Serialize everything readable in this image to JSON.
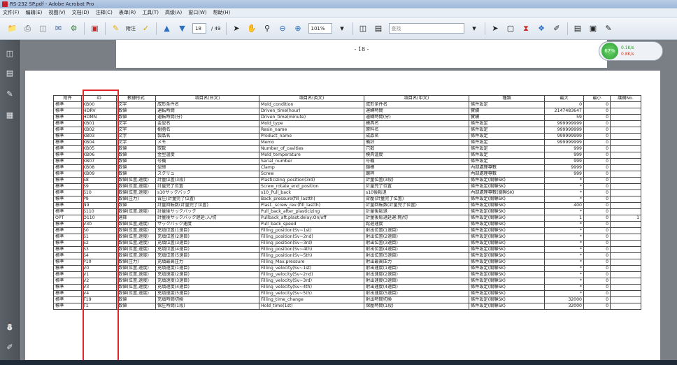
{
  "window": {
    "title": "RS-232 SP.pdf - Adobe Acrobat Pro"
  },
  "menu": [
    "文件(F)",
    "编辑(E)",
    "视图(V)",
    "文档(D)",
    "注释(C)",
    "表单(R)",
    "工具(T)",
    "高级(A)",
    "窗口(W)",
    "帮助(H)"
  ],
  "toolbar": {
    "attach_label": "附注",
    "page_current": "18",
    "page_total": "/ 49",
    "zoom_value": "101%",
    "search_placeholder": "查找"
  },
  "doc": {
    "page_number": "- 18 -"
  },
  "zoom_widget": {
    "percent": "67%",
    "up": "0.1K/s",
    "down": "0.8K/s"
  },
  "table": {
    "headers": [
      "附件",
      "ID",
      "數據形式",
      "項目名(日文)",
      "項目名(英文)",
      "項目名(中文)",
      "種類",
      "最大",
      "最小",
      "護欄No."
    ],
    "rows": [
      [
        "標準",
        "KB00",
        "文字",
        "成形条件名",
        "Mold_condition",
        "成形条件名",
        "條件設定",
        "0",
        "0",
        ""
      ],
      [
        "標準",
        "HDRV",
        "数値",
        "運転時間",
        "Driven_time(hour)",
        "運轉時間",
        "實績",
        "2147483647",
        "0",
        ""
      ],
      [
        "標準",
        "HDMN",
        "数値",
        "運転時間(分)",
        "Driven_time(minute)",
        "運轉時間(分)",
        "實績",
        "59",
        "0",
        ""
      ],
      [
        "標準",
        "KB01",
        "文字",
        "金型名",
        "Mold_type",
        "模具名",
        "條件設定",
        "999999999",
        "0",
        ""
      ],
      [
        "標準",
        "KB02",
        "文字",
        "樹脂名",
        "Resin_name",
        "原料名",
        "條件設定",
        "999999999",
        "0",
        ""
      ],
      [
        "標準",
        "KB03",
        "文字",
        "製品名",
        "Product_name",
        "成品名",
        "條件設定",
        "999999999",
        "0",
        ""
      ],
      [
        "標準",
        "KB04",
        "文字",
        "メモ",
        "Memo",
        "備註",
        "條件設定",
        "999999999",
        "0",
        ""
      ],
      [
        "標準",
        "KB05",
        "数値",
        "取数",
        "Number_of_cavities",
        "穴数",
        "條件設定",
        "999",
        "0",
        ""
      ],
      [
        "標準",
        "KB06",
        "数値",
        "金型温度",
        "Mold_temperature",
        "模具溫度",
        "條件設定",
        "999",
        "0",
        ""
      ],
      [
        "標準",
        "KB07",
        "数値",
        "号機",
        "Serial_number",
        "号機",
        "條件設定",
        "999",
        "0",
        ""
      ],
      [
        "標準",
        "KB08",
        "数値",
        "型締",
        "Clamp",
        "鎖模",
        "內部處理專數",
        "9999",
        "0",
        ""
      ],
      [
        "標準",
        "KB09",
        "数値",
        "スクリュ",
        "Screw",
        "螺桿",
        "內部處理專數",
        "999",
        "0",
        ""
      ],
      [
        "標準",
        "S8",
        "数値(位置,速度)",
        "計量位置(3段)",
        "Plasticizing_position(3rd)",
        "計量位置(3段)",
        "條件設定(關聯SK)",
        "*",
        "0",
        ""
      ],
      [
        "標準",
        "S9",
        "数値(位置,速度)",
        "計量完了位置",
        "Screw_rotate_end_position",
        "計量完了位置",
        "條件設定(關聯SK)",
        "*",
        "0",
        ""
      ],
      [
        "標準",
        "S10",
        "数値(位置,速度)",
        "s10サックバック",
        "s10_Pull_back",
        "s10後鬆退",
        "內部處理專數(關聯SK)",
        "*",
        "0",
        ""
      ],
      [
        "標準",
        "P9",
        "数値(圧力)",
        "背圧(計量完了位置)",
        "Back_pressure(fill_lastth)",
        "背壓(計量完了位置)",
        "條件設定(關聯SK)",
        "*",
        "0",
        ""
      ],
      [
        "標準",
        "N9",
        "数値",
        "計量回転数(計量完了位置)",
        "Plast._screw_rev.(fill_lastth)",
        "計量回転数(計量完了位置)",
        "條件設定(關聯SK)",
        "400",
        "0",
        ""
      ],
      [
        "標準",
        "S110",
        "数値(位置,速度)",
        "計量後サックバック",
        "Pull_back_after_plasticizing",
        "計量後鬆退",
        "條件設定(關聯SK)",
        "*",
        "0",
        ""
      ],
      [
        "OPT",
        "O110",
        "選擇",
        "計量後サックバック遅延:入/切",
        "Pullback_aft.plast.delay:On/off",
        "計量後鬆退延遲:開/切",
        "條件設定(關聯SK)",
        "1",
        "0",
        "1"
      ],
      [
        "標準",
        "V30",
        "数値(位置,速度)",
        "サックバック速度",
        "Pull_back_speed",
        "鬆退速度",
        "條件設定(關聯SK)",
        "*",
        "0",
        ""
      ],
      [
        "標準",
        "S0",
        "数値(位置,速度)",
        "充填位置(1速目)",
        "Filling_position(Sv~1st)",
        "射出位置(1速目)",
        "條件設定(關聯SK)",
        "*",
        "0",
        ""
      ],
      [
        "標準",
        "S1",
        "数値(位置,速度)",
        "充填位置(2速目)",
        "Filling_position(Sv~2nd)",
        "射出位置(2速目)",
        "條件設定(關聯SK)",
        "*",
        "0",
        ""
      ],
      [
        "標準",
        "S2",
        "数値(位置,速度)",
        "充填位置(3速目)",
        "Filling_position(Sv~3rd)",
        "射出位置(3速目)",
        "條件設定(關聯SK)",
        "*",
        "0",
        ""
      ],
      [
        "標準",
        "S3",
        "数値(位置,速度)",
        "充填位置(4速目)",
        "Filling_position(Sv~4th)",
        "射出位置(4速目)",
        "條件設定(關聯SK)",
        "*",
        "0",
        ""
      ],
      [
        "標準",
        "S4",
        "数値(位置,速度)",
        "充填位置(5速目)",
        "Filling_position(Sv~5th)",
        "射出位置(5速目)",
        "條件設定(關聯SK)",
        "*",
        "0",
        ""
      ],
      [
        "標準",
        "P10",
        "数値(圧力)",
        "充填最高圧力",
        "Filling_Max.pressure",
        "射出最高压力",
        "條件設定(關聯SK)",
        "*",
        "0",
        ""
      ],
      [
        "標準",
        "V0",
        "数値(位置,速度)",
        "充填速度(1速目)",
        "Filling_velocity(Sv~1st)",
        "射出速度(1速目)",
        "條件設定(關聯SK)",
        "*",
        "0",
        ""
      ],
      [
        "標準",
        "V1",
        "数値(位置,速度)",
        "充填速度(2速目)",
        "Filling_velocity(Sv~2nd)",
        "射出速度(2速目)",
        "條件設定(關聯SK)",
        "*",
        "0",
        ""
      ],
      [
        "標準",
        "V2",
        "数値(位置,速度)",
        "充填速度(3速目)",
        "Filling_velocity(Sv~3rd)",
        "射出速度(3速目)",
        "條件設定(關聯SK)",
        "*",
        "0",
        ""
      ],
      [
        "標準",
        "V3",
        "数値(位置,速度)",
        "充填速度(4速目)",
        "Filling_velocity(Sv~4th)",
        "射出速度(4速目)",
        "條件設定(關聯SK)",
        "*",
        "0",
        ""
      ],
      [
        "標準",
        "V4",
        "数値(位置,速度)",
        "充填速度(5速目)",
        "Filling_velocity(Sv~5th)",
        "射出速度(5速目)",
        "條件設定(關聯SK)",
        "*",
        "0",
        ""
      ],
      [
        "標準",
        "T19",
        "数値",
        "充填時間切換",
        "Filling_time_change",
        "射出時間切換",
        "條件設定(關聯SK)",
        "32000",
        "0",
        ""
      ],
      [
        "標準",
        "T1",
        "数値",
        "保圧時間(1段)",
        "Hold_time(1st)",
        "保壓時間(1段)",
        "條件設定(關聯SK)",
        "32000",
        "0",
        ""
      ]
    ]
  }
}
